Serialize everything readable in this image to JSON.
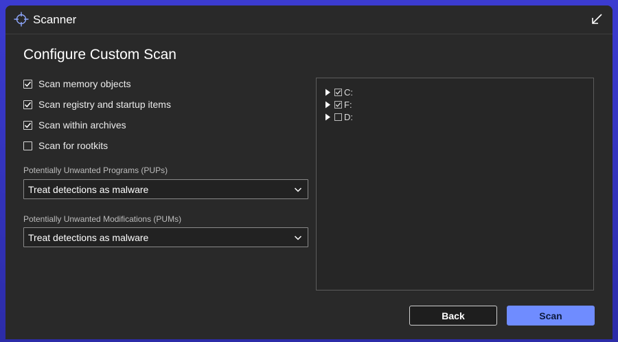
{
  "window": {
    "title": "Scanner",
    "icon": "crosshair-icon",
    "restore_icon": "restore-arrow-icon"
  },
  "main": {
    "heading": "Configure Custom Scan",
    "options": [
      {
        "label": "Scan memory objects",
        "checked": true
      },
      {
        "label": "Scan registry and startup items",
        "checked": true
      },
      {
        "label": "Scan within archives",
        "checked": true
      },
      {
        "label": "Scan for rootkits",
        "checked": false
      }
    ],
    "pups": {
      "label": "Potentially Unwanted Programs (PUPs)",
      "value": "Treat detections as malware"
    },
    "pums": {
      "label": "Potentially Unwanted Modifications (PUMs)",
      "value": "Treat detections as malware"
    }
  },
  "drives": [
    {
      "label": "C:",
      "checked": true
    },
    {
      "label": "F:",
      "checked": true
    },
    {
      "label": "D:",
      "checked": false
    }
  ],
  "buttons": {
    "back": "Back",
    "scan": "Scan"
  },
  "colors": {
    "accent": "#6f8cff",
    "background": "#292929"
  }
}
